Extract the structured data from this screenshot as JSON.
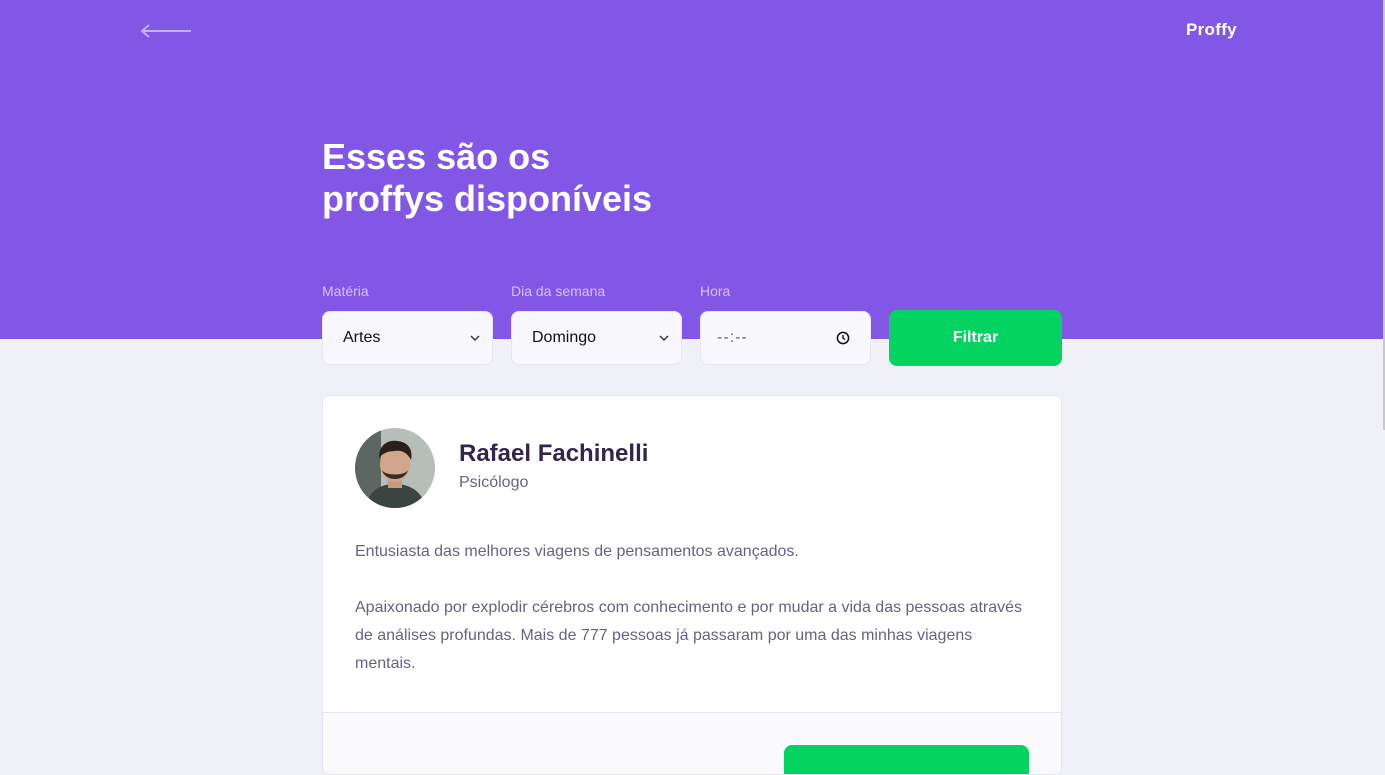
{
  "colors": {
    "primary": "#8257e5",
    "secondary": "#04d361",
    "background": "#f0f0f7"
  },
  "header": {
    "back_icon": "arrow-left-icon",
    "logo_text": "Proffy",
    "title_line1": "Esses são os",
    "title_line2": "proffys disponíveis"
  },
  "filters": {
    "subject": {
      "label": "Matéria",
      "value": "Artes"
    },
    "weekday": {
      "label": "Dia da semana",
      "value": "Domingo"
    },
    "time": {
      "label": "Hora",
      "value": "--:--",
      "icon": "clock-icon"
    },
    "submit_label": "Filtrar"
  },
  "teacher": {
    "name": "Rafael Fachinelli",
    "subject": "Psicólogo",
    "bio_1": "Entusiasta das melhores viagens de pensamentos avançados.",
    "bio_2": "Apaixonado por explodir cérebros com conhecimento e por mudar a vida das pessoas através de análises profundas. Mais de 777 pessoas já passaram por uma das minhas viagens mentais."
  }
}
